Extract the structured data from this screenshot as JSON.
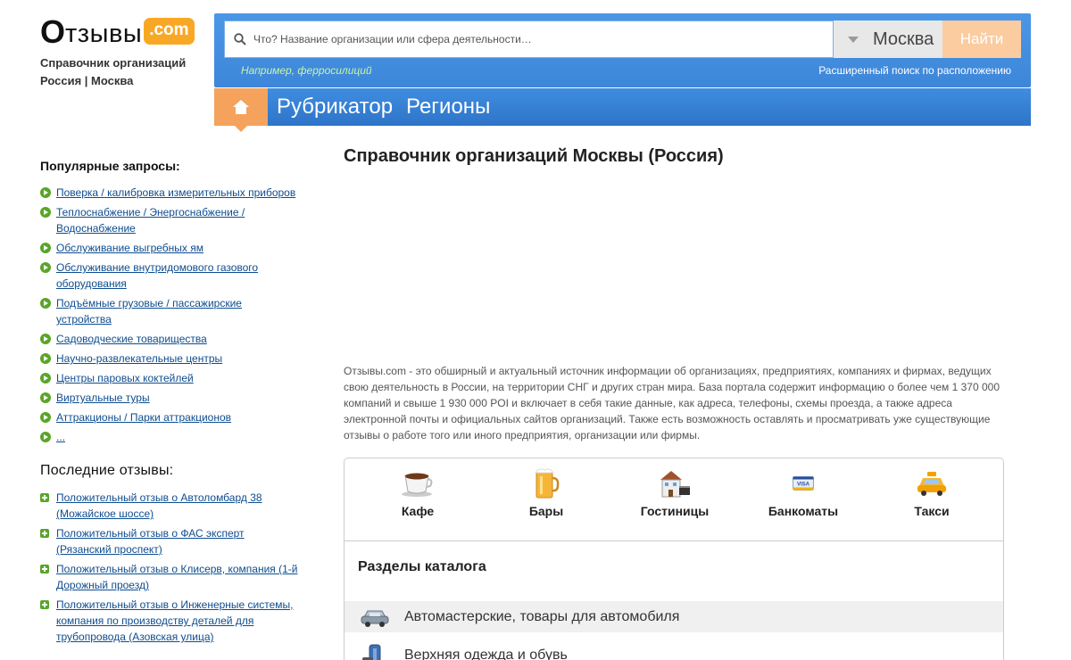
{
  "logo": {
    "first_letter": "О",
    "rest": "тзывы",
    "badge": ".com",
    "subtitle_line1": "Справочник организаций",
    "subtitle_line2": "Россия | Москва"
  },
  "search": {
    "placeholder": "Что? Название организации или сфера деятельности…",
    "city": "Москва",
    "button_label": "Найти",
    "example": "Например, ферросилиций",
    "advanced_link": "Расширенный поиск по расположению"
  },
  "nav": {
    "items": [
      "Рубрикатор",
      "Регионы"
    ]
  },
  "sidebar": {
    "popular_title": "Популярные запросы:",
    "popular": [
      "Поверка / калибровка измерительных приборов",
      "Теплоснабжение / Энергоснабжение / Водоснабжение",
      "Обслуживание выгребных ям",
      "Обслуживание внутридомового газового оборудования",
      "Подъёмные грузовые / пассажирские устройства",
      "Садоводческие товарищества",
      "Научно-развлекательные центры",
      "Центры паровых коктейлей",
      "Виртуальные туры",
      "Аттракционы / Парки аттракционов",
      "..."
    ],
    "reviews_title": "Последние отзывы:",
    "reviews": [
      "Положительный отзыв о Автоломбард 38 (Можайское шоссе)",
      "Положительный отзыв о ФАС эксперт (Рязанский проспект)",
      "Положительный отзыв о Клисерв, компания (1-й Дорожный проезд)",
      "Положительный отзыв о Инженерные системы, компания по производству деталей для трубопровода (Азовская улица)"
    ]
  },
  "main": {
    "title": "Справочник организаций Москвы (Россия)",
    "description": "Отзывы.com - это обширный и актуальный источник информации об организациях, предприятиях, компаниях и фирмах, ведущих свою деятельность в России, на территории СНГ и других стран мира. База портала содержит информацию о более чем 1 370 000 компаний и свыше 1 930 000 POI и включает в себя такие данные, как адреса, телефоны, схемы проезда, а также адреса электронной почты и официальных сайтов организаций. Также есть возможность оставлять и просматривать уже существующие отзывы о работе того или иного предприятия, организации или фирмы."
  },
  "quick_links": [
    {
      "label": "Кафе",
      "icon": "coffee-cup-icon"
    },
    {
      "label": "Бары",
      "icon": "beer-mug-icon"
    },
    {
      "label": "Гостиницы",
      "icon": "hotel-building-icon"
    },
    {
      "label": "Банкоматы",
      "icon": "visa-card-icon"
    },
    {
      "label": "Такси",
      "icon": "taxi-car-icon"
    }
  ],
  "catalog": {
    "title": "Разделы каталога",
    "sections": [
      {
        "label": "Автомастерские, товары для автомобиля",
        "icon": "car-icon"
      },
      {
        "label": "Верхняя одежда и обувь",
        "icon": "clothing-icon"
      }
    ]
  },
  "colors": {
    "header_blue": "#3d86d9",
    "accent_orange": "#f4a25c",
    "link_blue": "#0e4d8f",
    "bullet_green": "#5aa529"
  }
}
